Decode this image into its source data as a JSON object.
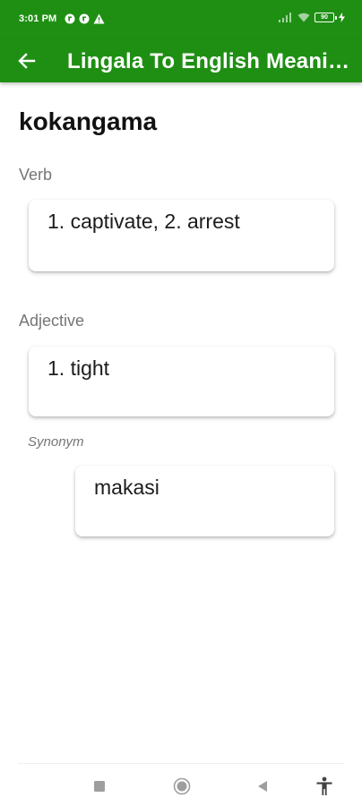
{
  "status_bar": {
    "time": "3:01 PM",
    "battery": "90",
    "icons_left": [
      "notification-icon",
      "notification-icon",
      "warning-icon"
    ],
    "icons_right": [
      "signal-icon",
      "wifi-icon",
      "battery-icon",
      "charging-icon"
    ]
  },
  "app_bar": {
    "title": "Lingala To English Meaning",
    "back_icon": "arrow-left-icon",
    "color": "#1f8f14"
  },
  "entry": {
    "word": "kokangama",
    "sections": [
      {
        "pos": "Verb",
        "meaning": "1. captivate, 2. arrest"
      },
      {
        "pos": "Adjective",
        "meaning": "1. tight"
      }
    ],
    "synonym": {
      "label": "Synonym",
      "value": "makasi"
    }
  },
  "nav": {
    "icons": [
      "recents-square-icon",
      "home-circle-icon",
      "back-triangle-icon",
      "accessibility-icon"
    ]
  }
}
